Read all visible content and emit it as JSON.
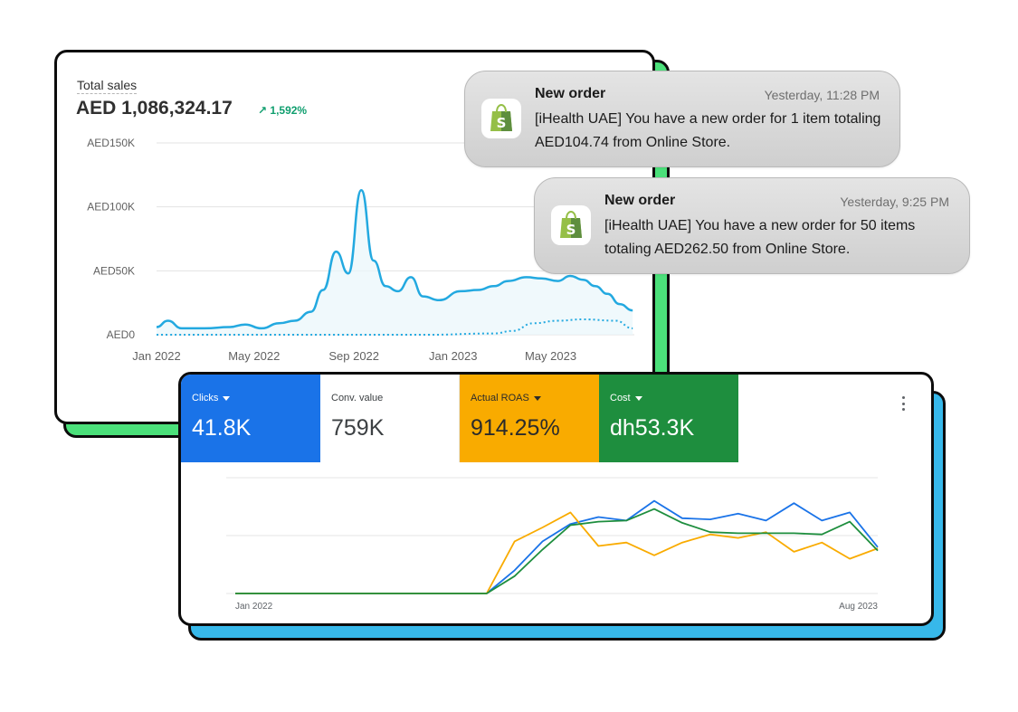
{
  "sales": {
    "title": "Total sales",
    "total": "AED 1,086,324.17",
    "growth": "1,592%",
    "growth_icon": "arrow-up-right-icon",
    "y_ticks": [
      "AED150K",
      "AED100K",
      "AED50K",
      "AED0"
    ],
    "x_ticks": [
      "Jan 2022",
      "May 2022",
      "Sep 2022",
      "Jan 2023",
      "May 2023"
    ]
  },
  "notifications": [
    {
      "title": "New order",
      "time": "Yesterday, 11:28 PM",
      "body": "[iHealth UAE] You have a new order for 1 item totaling AED104.74 from Online Store.",
      "icon": "shopify-bag-icon"
    },
    {
      "title": "New order",
      "time": "Yesterday, 9:25 PM",
      "body": "[iHealth UAE] You have a new order for 50 items totaling AED262.50 from Online Store.",
      "icon": "shopify-bag-icon"
    }
  ],
  "ads": {
    "metrics": [
      {
        "label": "Clicks",
        "value": "41.8K",
        "has_dropdown": true
      },
      {
        "label": "Conv. value",
        "value": "759K",
        "has_dropdown": false
      },
      {
        "label": "Actual ROAS",
        "value": "914.25%",
        "has_dropdown": true
      },
      {
        "label": "Cost",
        "value": "dh53.3K",
        "has_dropdown": true
      }
    ],
    "x_start": "Jan 2022",
    "x_end": "Aug 2023",
    "menu_icon": "more-vert-icon"
  },
  "colors": {
    "sales_line": "#23a9e0",
    "clicks": "#1a73e8",
    "roas": "#f9ab00",
    "cost": "#1e8e3e",
    "sales_card_shadow": "#4be07a",
    "ads_card_shadow": "#37b8ea"
  },
  "chart_data": [
    {
      "type": "line",
      "title": "Total sales",
      "xlabel": "",
      "ylabel": "",
      "ylim": [
        0,
        150000
      ],
      "x_range": [
        "2022-01",
        "2023-08"
      ],
      "y_ticks": [
        0,
        50000,
        100000,
        150000
      ],
      "grid": true,
      "series": [
        {
          "style": "solid",
          "points": [
            [
              "2022-01-01",
              6000
            ],
            [
              "2022-01-15",
              11000
            ],
            [
              "2022-02-01",
              5000
            ],
            [
              "2022-03-01",
              5000
            ],
            [
              "2022-04-01",
              6000
            ],
            [
              "2022-04-20",
              8000
            ],
            [
              "2022-05-10",
              5000
            ],
            [
              "2022-06-01",
              9000
            ],
            [
              "2022-06-20",
              11000
            ],
            [
              "2022-07-10",
              18000
            ],
            [
              "2022-07-25",
              35000
            ],
            [
              "2022-08-10",
              65000
            ],
            [
              "2022-08-25",
              48000
            ],
            [
              "2022-09-10",
              113000
            ],
            [
              "2022-09-25",
              58000
            ],
            [
              "2022-10-10",
              38000
            ],
            [
              "2022-10-25",
              34000
            ],
            [
              "2022-11-10",
              45000
            ],
            [
              "2022-11-25",
              30000
            ],
            [
              "2022-12-15",
              27000
            ],
            [
              "2023-01-10",
              34000
            ],
            [
              "2023-02-01",
              35000
            ],
            [
              "2023-02-20",
              38000
            ],
            [
              "2023-03-10",
              42000
            ],
            [
              "2023-04-01",
              45000
            ],
            [
              "2023-04-20",
              44000
            ],
            [
              "2023-05-10",
              42000
            ],
            [
              "2023-05-25",
              46000
            ],
            [
              "2023-06-10",
              43000
            ],
            [
              "2023-06-25",
              38000
            ],
            [
              "2023-07-10",
              32000
            ],
            [
              "2023-07-25",
              24000
            ],
            [
              "2023-08-10",
              19000
            ]
          ]
        },
        {
          "style": "dotted",
          "points": [
            [
              "2022-01-01",
              0
            ],
            [
              "2022-06-01",
              0
            ],
            [
              "2022-12-01",
              0
            ],
            [
              "2023-02-20",
              1000
            ],
            [
              "2023-03-15",
              3000
            ],
            [
              "2023-04-10",
              9000
            ],
            [
              "2023-05-10",
              11000
            ],
            [
              "2023-06-10",
              12000
            ],
            [
              "2023-07-20",
              11000
            ],
            [
              "2023-08-10",
              5000
            ]
          ]
        }
      ]
    },
    {
      "type": "line",
      "title": "",
      "x_labels": [
        "Jan 2022",
        "Aug 2023"
      ],
      "grid": true,
      "y_axis_labels_shown": false,
      "note": "values on relative 0-100 scale",
      "series": [
        {
          "metric": "Clicks",
          "color": "#1a73e8",
          "values": [
            0,
            0,
            0,
            0,
            0,
            0,
            0,
            0,
            0,
            0,
            20,
            45,
            60,
            66,
            63,
            80,
            65,
            64,
            69,
            63,
            78,
            63,
            70,
            40
          ]
        },
        {
          "metric": "Actual ROAS",
          "color": "#f9ab00",
          "values": [
            0,
            0,
            0,
            0,
            0,
            0,
            0,
            0,
            0,
            0,
            45,
            57,
            70,
            41,
            44,
            33,
            44,
            51,
            48,
            53,
            36,
            44,
            30,
            39
          ]
        },
        {
          "metric": "Cost",
          "color": "#1e8e3e",
          "values": [
            0,
            0,
            0,
            0,
            0,
            0,
            0,
            0,
            0,
            0,
            15,
            38,
            59,
            62,
            63,
            73,
            61,
            53,
            52,
            52,
            52,
            51,
            62,
            37
          ]
        }
      ]
    }
  ]
}
